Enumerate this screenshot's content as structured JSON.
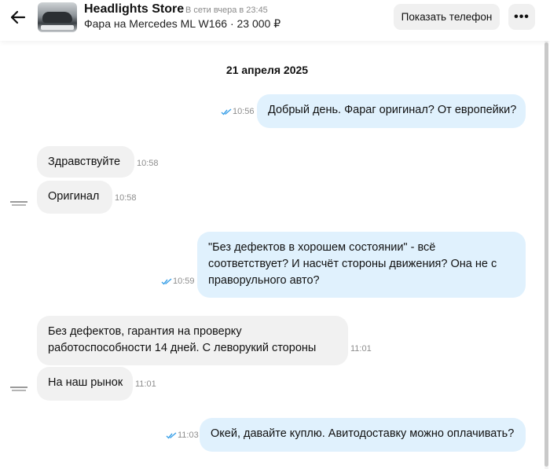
{
  "header": {
    "shop_name": "Headlights Store",
    "status": "В сети вчера в 23:45",
    "listing": "Фара на Mercedes ML W166 · 23 000 ₽",
    "phone_button": "Показать телефон",
    "more_icon": "more-horizontal-icon",
    "back_icon": "arrow-left-icon"
  },
  "chat": {
    "date": "21 апреля 2025",
    "messages": [
      {
        "side": "out",
        "text": "Добрый день. Фараг оригинал? От европейки?",
        "time": "10:56"
      },
      {
        "side": "in",
        "text": "Здравствуйте",
        "time": "10:58"
      },
      {
        "side": "in",
        "text": "Оригинал",
        "time": "10:58"
      },
      {
        "side": "out",
        "lines": [
          "\"Без дефектов в хорошем состоянии\" - всё",
          "соответствует? И насчёт стороны движения? Она не с",
          "праворульного авто?"
        ],
        "time": "10:59"
      },
      {
        "side": "in",
        "lines": [
          "Без дефектов, гарантия на проверку",
          "работоспособности 14 дней. С леворукий стороны"
        ],
        "time": "11:01"
      },
      {
        "side": "in",
        "text": "На наш рынок",
        "time": "11:01"
      },
      {
        "side": "out",
        "text": "Окей, давайте куплю. Авитодоставку можно оплачивать?",
        "time": "11:03"
      }
    ]
  },
  "colors": {
    "outgoing_bubble": "#e0f1fd",
    "incoming_bubble": "#f1f1f1",
    "read_ticks": "#3aa0e8"
  }
}
